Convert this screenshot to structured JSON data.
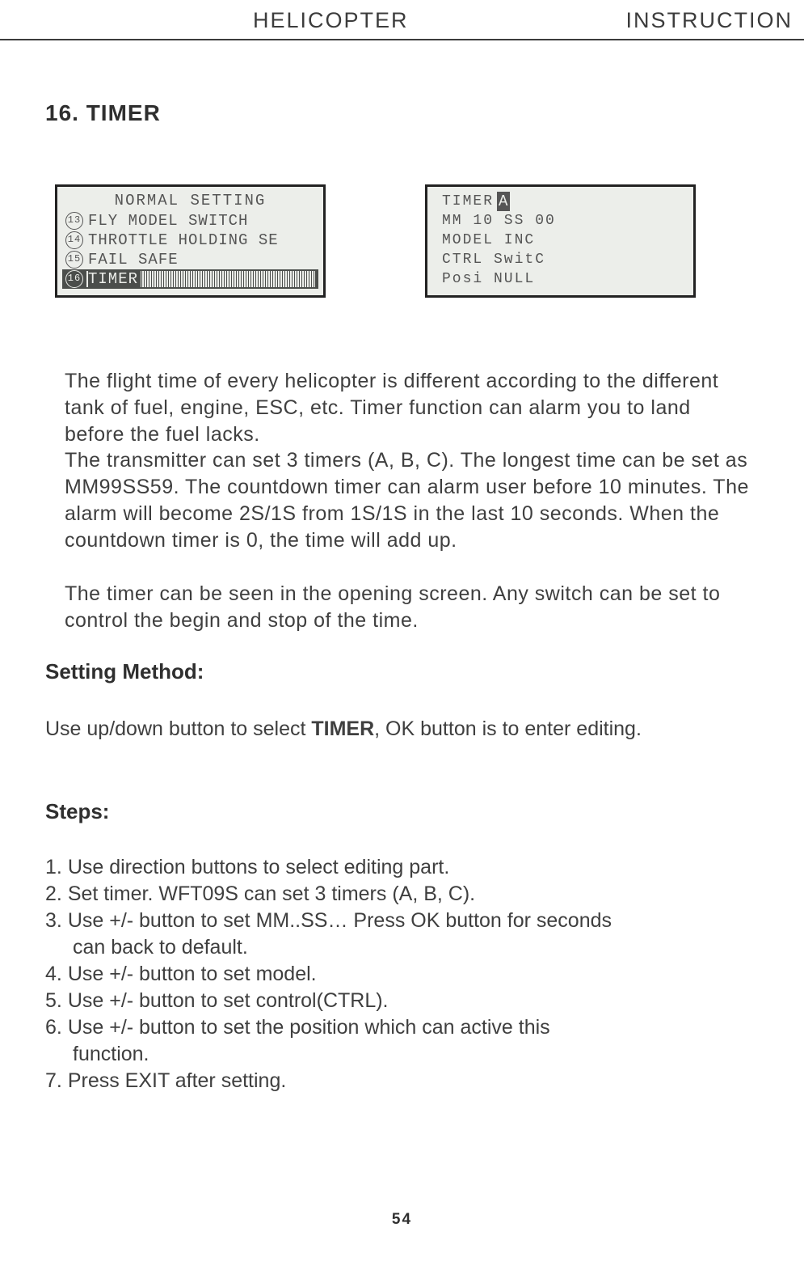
{
  "header": {
    "left": "HELICOPTER",
    "right": "INSTRUCTION"
  },
  "section_title": "16. TIMER",
  "lcd_left": {
    "title": "NORMAL SETTING",
    "rows": [
      {
        "num": "13",
        "label": "FLY MODEL SWITCH",
        "selected": false
      },
      {
        "num": "14",
        "label": "THROTTLE HOLDING SE",
        "selected": false
      },
      {
        "num": "15",
        "label": "FAIL SAFE",
        "selected": false
      },
      {
        "num": "16",
        "label": "TIMER",
        "selected": true
      }
    ]
  },
  "lcd_right": {
    "rows": [
      {
        "label": "TIMER",
        "box": "A"
      },
      {
        "label": "MM 10 SS 00"
      },
      {
        "label": "MODEL  INC"
      },
      {
        "label": "CTRL SwitC"
      },
      {
        "label": "Posi NULL"
      }
    ]
  },
  "paragraphs": {
    "p1": "The flight time of every helicopter is different according to the different tank of fuel, engine, ESC, etc. Timer function can alarm you to land before the fuel lacks.",
    "p2": "The transmitter can set 3 timers (A, B, C). The longest time can be set as MM99SS59. The countdown timer can alarm user before 10 minutes. The alarm will become 2S/1S from 1S/1S  in the last 10 seconds. When the countdown timer is 0, the time will add up.",
    "p3": "The timer can be seen in the opening screen. Any switch can be set to control the begin and stop of the time."
  },
  "setting_method_label": "Setting Method:",
  "setting_method_text_pre": "Use up/down button to select ",
  "setting_method_text_bold": "TIMER",
  "setting_method_text_post": ", OK button is to enter  editing.",
  "steps_label": "Steps:",
  "steps": [
    {
      "n": "1.",
      "text": "Use direction buttons to select editing part."
    },
    {
      "n": "2.",
      "text": "Set timer. WFT09S can set 3 timers (A, B, C)."
    },
    {
      "n": "3.",
      "text": "Use +/- button to set MM..SS… Press OK button for seconds",
      "cont": "can back to default."
    },
    {
      "n": "4.",
      "text": "Use +/- button to set model."
    },
    {
      "n": "5.",
      "text": "Use +/- button to set control(CTRL)."
    },
    {
      "n": "6.",
      "text": "Use +/- button to set the position which can  active this",
      "cont": "function."
    },
    {
      "n": "7.",
      "text": "Press EXIT after setting."
    }
  ],
  "page_number": "54"
}
